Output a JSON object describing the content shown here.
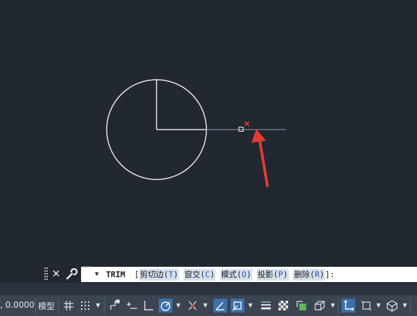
{
  "command_line": {
    "command": "TRIM",
    "open_bracket": "[",
    "options": [
      {
        "text": "剪切边(",
        "key": "T",
        "close": ")"
      },
      {
        "text": "窗交(",
        "key": "C",
        "close": ")"
      },
      {
        "text": "模式(",
        "key": "O",
        "close": ")"
      },
      {
        "text": "投影(",
        "key": "P",
        "close": ")"
      },
      {
        "text": "删除(",
        "key": "R",
        "close": ")"
      }
    ],
    "close_bracket": "]:",
    "close_icon": "close-icon",
    "customize_icon": "wrench-icon"
  },
  "status_bar": {
    "coordinates": ", 0.0000",
    "model_tab": "模型",
    "icons": [
      "grid-icon",
      "snap-icon",
      "infer-constraints-icon",
      "dynamic-input-icon",
      "ortho-icon",
      "polar-tracking-icon",
      "isodraft-icon",
      "object-snap-tracking-icon",
      "object-snap-icon",
      "lineweight-icon",
      "transparency-icon",
      "selection-cycling-icon",
      "3d-object-snap-icon",
      "dynamic-ucs-icon",
      "selection-filter-icon",
      "gizmo-icon"
    ]
  },
  "canvas": {
    "background": "#212830",
    "geometry_color": "#e8e8e8",
    "pointer_color": "#e53935",
    "objects": [
      "circle",
      "vertical-radius-line",
      "horizontal-radius-line",
      "extension-line",
      "pickbox-cursor",
      "trim-marker",
      "annotation-arrow"
    ]
  },
  "colors": {
    "statusbar_bg": "#3b4450",
    "active_button": "#3d6fa8",
    "option_highlight": "#d7e1ee"
  }
}
